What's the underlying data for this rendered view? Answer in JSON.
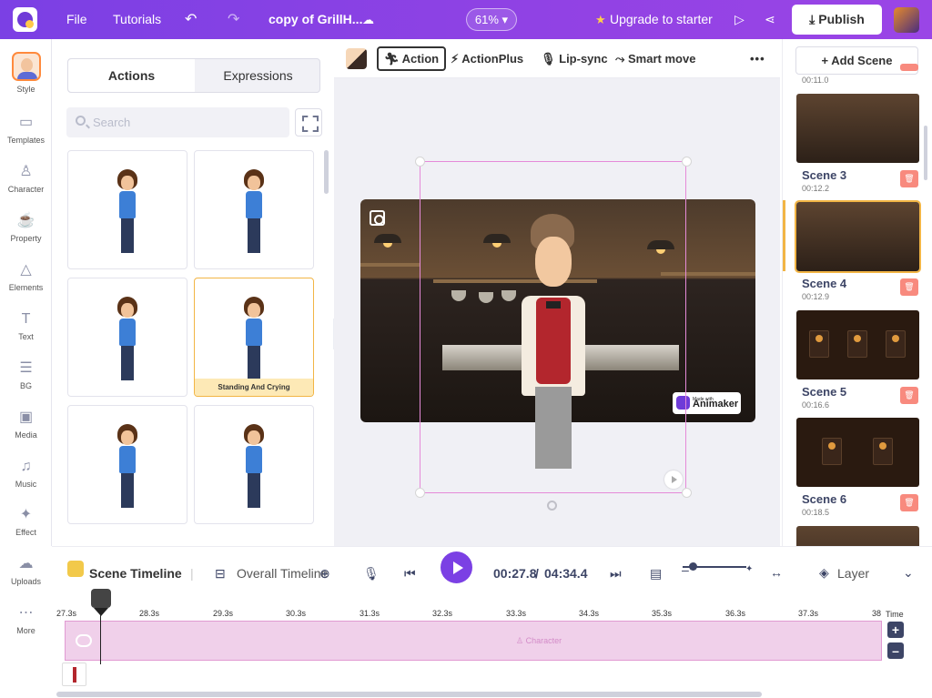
{
  "topbar": {
    "file": "File",
    "tutorials": "Tutorials",
    "project_title": "copy of GrillH...",
    "zoom": "61%",
    "upgrade": "Upgrade to starter",
    "publish": "Publish"
  },
  "leftnav": {
    "items": [
      {
        "label": "Style",
        "icon": "style-avatar-icon"
      },
      {
        "label": "Templates",
        "icon": "templates-icon"
      },
      {
        "label": "Character",
        "icon": "character-icon"
      },
      {
        "label": "Property",
        "icon": "property-icon"
      },
      {
        "label": "Elements",
        "icon": "elements-icon"
      },
      {
        "label": "Text",
        "icon": "text-icon"
      },
      {
        "label": "BG",
        "icon": "bg-icon"
      },
      {
        "label": "Media",
        "icon": "media-icon"
      },
      {
        "label": "Music",
        "icon": "music-icon"
      },
      {
        "label": "Effect",
        "icon": "effect-icon"
      },
      {
        "label": "Uploads",
        "icon": "uploads-icon"
      },
      {
        "label": "More",
        "icon": "more-icon"
      }
    ]
  },
  "panel": {
    "tab_actions": "Actions",
    "tab_expressions": "Expressions",
    "search_placeholder": "Search",
    "selected_caption": "Standing And Crying"
  },
  "toolbar": {
    "action": "Action",
    "actionplus": "ActionPlus",
    "lipsync": "Lip-sync",
    "smartmove": "Smart move"
  },
  "canvas": {
    "watermark_small": "Made with",
    "watermark": "Animaker"
  },
  "scenes": {
    "add": "+ Add Scene",
    "top_time": "00:11.0",
    "list": [
      {
        "name": "Scene 3",
        "time": "00:12.2"
      },
      {
        "name": "Scene 4",
        "time": "00:12.9"
      },
      {
        "name": "Scene 5",
        "time": "00:16.6"
      },
      {
        "name": "Scene 6",
        "time": "00:18.5"
      }
    ]
  },
  "timeline": {
    "scene_timeline": "Scene Timeline",
    "overall_timeline": "Overall Timeline",
    "current": "00:27.8",
    "separator": "/",
    "total": "04:34.4",
    "layer": "Layer",
    "time_label": "Time",
    "track_label": "Character",
    "ruler": [
      "27.3s",
      "28.3s",
      "29.3s",
      "30.3s",
      "31.3s",
      "32.3s",
      "33.3s",
      "34.3s",
      "35.3s",
      "36.3s",
      "37.3s",
      "38"
    ]
  },
  "colors": {
    "brand": "#7b40e4",
    "selected_scene": "#f2b545",
    "track": "#f0d0ea"
  }
}
